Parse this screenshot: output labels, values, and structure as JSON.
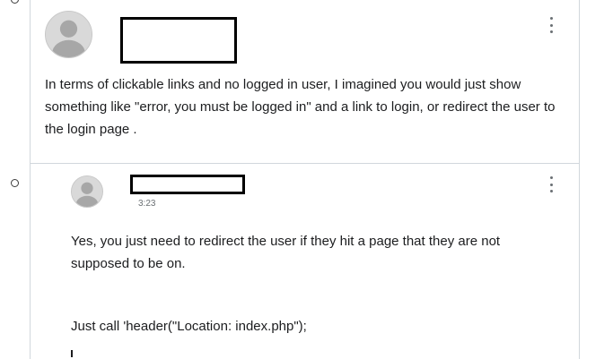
{
  "icons": {
    "avatar": "user-avatar-icon",
    "menu": "vertical-ellipsis-icon",
    "thread_node": "circle-outline-icon"
  },
  "comment_1": {
    "body": "In terms of clickable links and no logged in user, I imagined you would just show something like \"error, you must be logged in\" and a link to login, or redirect the user to the login page ."
  },
  "comment_2": {
    "timestamp": "3:23",
    "paragraph_1": "Yes, you just need to redirect the user if they hit a page that they are not supposed to be on.",
    "paragraph_2": "Just call 'header(\"Location: index.php\");"
  },
  "colors": {
    "border": "#d1d7dc",
    "text": "#1c1d1f",
    "muted": "#6a6f73",
    "avatar_bg": "#d9d9d9"
  }
}
